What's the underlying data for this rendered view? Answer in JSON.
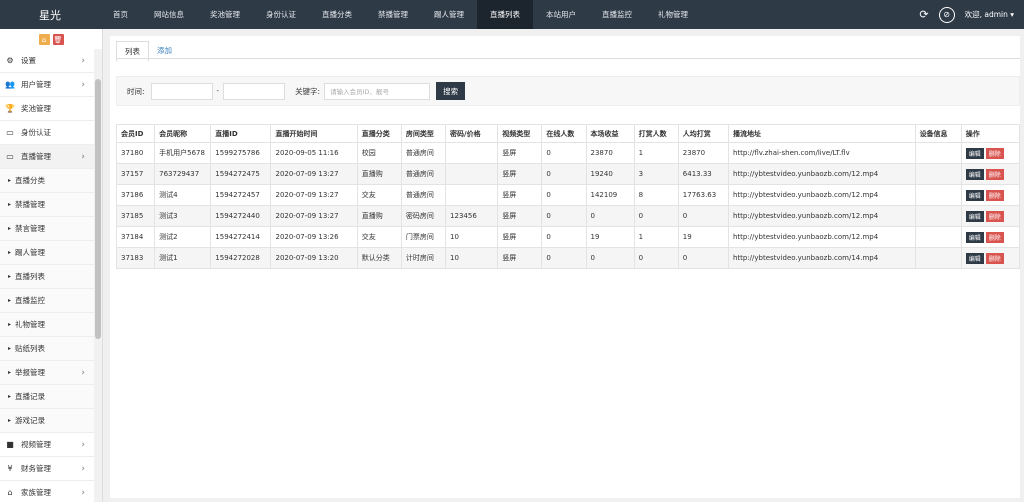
{
  "app": {
    "logo": "星光"
  },
  "nav": [
    {
      "label": "首页"
    },
    {
      "label": "网站信息"
    },
    {
      "label": "奖池管理"
    },
    {
      "label": "身份认证"
    },
    {
      "label": "直播分类"
    },
    {
      "label": "禁播管理"
    },
    {
      "label": "踢人管理"
    },
    {
      "label": "直播列表",
      "active": true
    },
    {
      "label": "本站用户"
    },
    {
      "label": "直播监控"
    },
    {
      "label": "礼物管理"
    }
  ],
  "user": {
    "welcome": "欢迎, admin ▾"
  },
  "sidebar": {
    "items": [
      {
        "icon": "gear-icon",
        "glyph": "⚙",
        "label": "设置",
        "arrow": true
      },
      {
        "icon": "users-icon",
        "glyph": "👥",
        "label": "用户管理",
        "arrow": true
      },
      {
        "icon": "trophy-icon",
        "glyph": "🏆",
        "label": "奖池管理"
      },
      {
        "icon": "monitor-icon",
        "glyph": "▭",
        "label": "身份认证"
      },
      {
        "icon": "monitor-icon",
        "glyph": "▭",
        "label": "直播管理",
        "arrow": true,
        "open": true
      },
      {
        "label": "直播分类",
        "sub": true
      },
      {
        "label": "禁播管理",
        "sub": true
      },
      {
        "label": "禁言管理",
        "sub": true
      },
      {
        "label": "踢人管理",
        "sub": true
      },
      {
        "label": "直播列表",
        "sub": true
      },
      {
        "label": "直播监控",
        "sub": true
      },
      {
        "label": "礼物管理",
        "sub": true
      },
      {
        "label": "贴纸列表",
        "sub": true
      },
      {
        "label": "举报管理",
        "sub": true,
        "arrow": true
      },
      {
        "label": "直播记录",
        "sub": true
      },
      {
        "label": "游戏记录",
        "sub": true
      },
      {
        "icon": "video-icon",
        "glyph": "■",
        "label": "视频管理",
        "arrow": true
      },
      {
        "icon": "yen-icon",
        "glyph": "¥",
        "label": "财务管理",
        "arrow": true
      },
      {
        "icon": "bank-icon",
        "glyph": "⌂",
        "label": "家族管理",
        "arrow": true
      }
    ]
  },
  "tabs": [
    {
      "label": "列表",
      "active": true
    },
    {
      "label": "添加"
    }
  ],
  "filter": {
    "time_label": "时间:",
    "sep": "-",
    "keyword_label": "关键字:",
    "keyword_placeholder": "请输入会员ID、靓号",
    "search_label": "搜索"
  },
  "table": {
    "columns": [
      "会员ID",
      "会员昵称",
      "直播ID",
      "直播开始时间",
      "直播分类",
      "房间类型",
      "密码/价格",
      "视频类型",
      "在线人数",
      "本场收益",
      "打赏人数",
      "人均打赏",
      "播流地址",
      "设备信息",
      "操作"
    ],
    "rows": [
      [
        "37180",
        "手机用户5678",
        "1599275786",
        "2020-09-05 11:16",
        "校园",
        "普通房间",
        "",
        "竖屏",
        "0",
        "23870",
        "1",
        "23870",
        "http://flv.zhai-shen.com/live/LT.flv",
        ""
      ],
      [
        "37157",
        "763729437",
        "1594272475",
        "2020-07-09 13:27",
        "直播购",
        "普通房间",
        "",
        "竖屏",
        "0",
        "19240",
        "3",
        "6413.33",
        "http://ybtestvideo.yunbaozb.com/12.mp4",
        ""
      ],
      [
        "37186",
        "测试4",
        "1594272457",
        "2020-07-09 13:27",
        "交友",
        "普通房间",
        "",
        "竖屏",
        "0",
        "142109",
        "8",
        "17763.63",
        "http://ybtestvideo.yunbaozb.com/12.mp4",
        ""
      ],
      [
        "37185",
        "测试3",
        "1594272440",
        "2020-07-09 13:27",
        "直播购",
        "密码房间",
        "123456",
        "竖屏",
        "0",
        "0",
        "0",
        "0",
        "http://ybtestvideo.yunbaozb.com/12.mp4",
        ""
      ],
      [
        "37184",
        "测试2",
        "1594272414",
        "2020-07-09 13:26",
        "交友",
        "门票房间",
        "10",
        "竖屏",
        "0",
        "19",
        "1",
        "19",
        "http://ybtestvideo.yunbaozb.com/12.mp4",
        ""
      ],
      [
        "37183",
        "测试1",
        "1594272028",
        "2020-07-09 13:20",
        "默认分类",
        "计时房间",
        "10",
        "竖屏",
        "0",
        "0",
        "0",
        "0",
        "http://ybtestvideo.yunbaozb.com/14.mp4",
        ""
      ]
    ],
    "edit_label": "编辑",
    "delete_label": "删除"
  }
}
